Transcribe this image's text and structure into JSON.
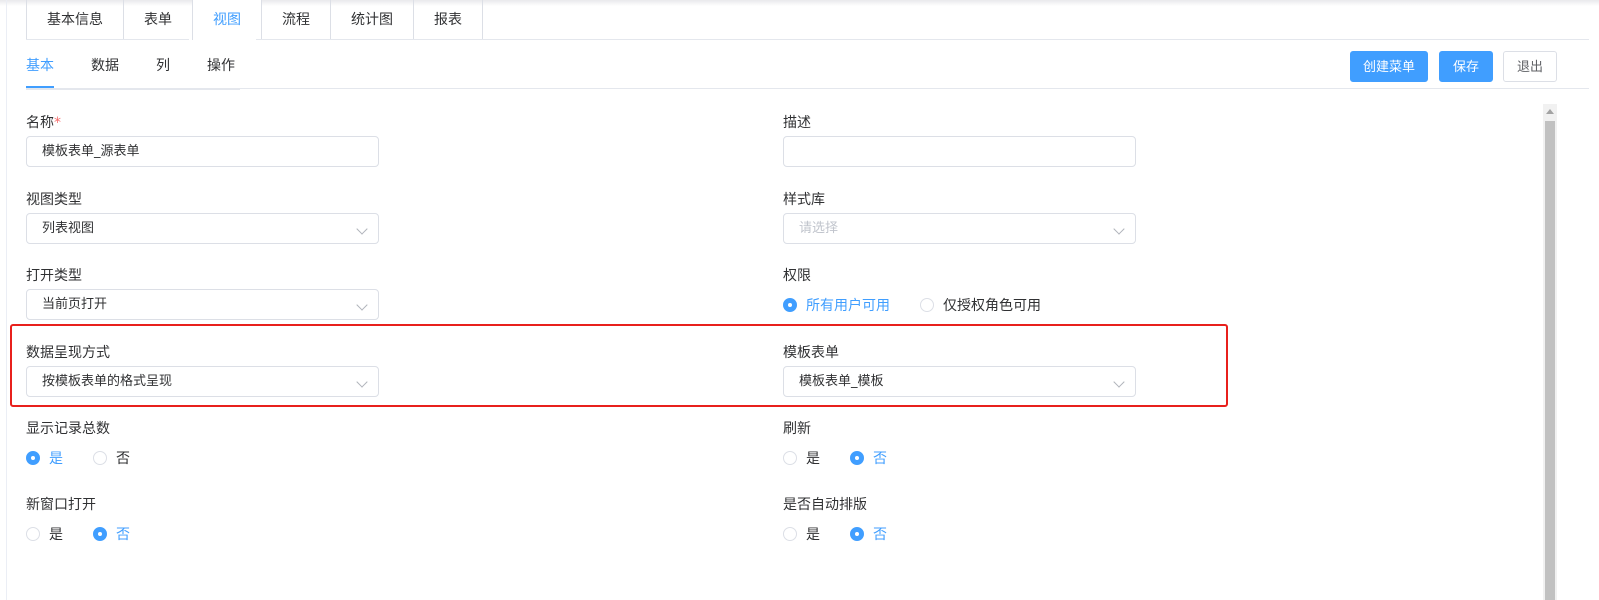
{
  "top_tabs": [
    "基本信息",
    "表单",
    "视图",
    "流程",
    "统计图",
    "报表"
  ],
  "active_top_tab": "视图",
  "sub_tabs": [
    "基本",
    "数据",
    "列",
    "操作"
  ],
  "active_sub_tab": "基本",
  "buttons": {
    "create_menu": "创建菜单",
    "save": "保存",
    "exit": "退出"
  },
  "form": {
    "name_label": "名称",
    "name_required_mark": "*",
    "name_value": "模板表单_源表单",
    "desc_label": "描述",
    "desc_value": "",
    "view_type_label": "视图类型",
    "view_type_value": "列表视图",
    "style_lib_label": "样式库",
    "style_lib_placeholder": "请选择",
    "open_type_label": "打开类型",
    "open_type_value": "当前页打开",
    "permission_label": "权限",
    "permission_options": [
      "所有用户可用",
      "仅授权角色可用"
    ],
    "permission_selected": "所有用户可用",
    "data_display_label": "数据呈现方式",
    "data_display_value": "按模板表单的格式呈现",
    "template_form_label": "模板表单",
    "template_form_value": "模板表单_模板",
    "show_total_label": "显示记录总数",
    "show_total_options": [
      "是",
      "否"
    ],
    "show_total_selected": "是",
    "refresh_label": "刷新",
    "refresh_options": [
      "是",
      "否"
    ],
    "refresh_selected": "否",
    "new_window_label": "新窗口打开",
    "new_window_options": [
      "是",
      "否"
    ],
    "new_window_selected": "否",
    "auto_layout_label": "是否自动排版",
    "auto_layout_options": [
      "是",
      "否"
    ],
    "auto_layout_selected": "否"
  },
  "colors": {
    "primary": "#409eff",
    "highlight": "#e8201c",
    "required": "#f56c6c"
  }
}
